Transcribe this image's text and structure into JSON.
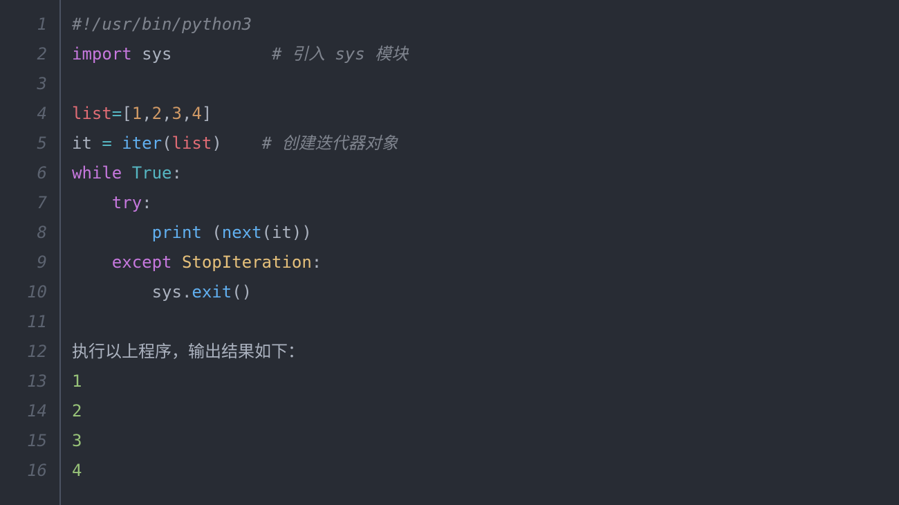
{
  "gutter": {
    "1": "1",
    "2": "2",
    "3": "3",
    "4": "4",
    "5": "5",
    "6": "6",
    "7": "7",
    "8": "8",
    "9": "9",
    "10": "10",
    "11": "11",
    "12": "12",
    "13": "13",
    "14": "14",
    "15": "15",
    "16": "16"
  },
  "t": {
    "shebang": "#!/usr/bin/python3",
    "import": "import",
    "sys": "sys",
    "c_import": "# 引入 sys 模块",
    "list": "list",
    "eq": "=",
    "lbr": "[",
    "n1": "1",
    "n2": "2",
    "n3": "3",
    "n4": "4",
    "comma": ",",
    "rbr": "]",
    "it": "it",
    "sp": " ",
    "iter": "iter",
    "lpar": "(",
    "rpar": ")",
    "c_iter": "# 创建迭代器对象",
    "while": "while",
    "true": "True",
    "colon": ":",
    "try": "try",
    "print": "print",
    "next": "next",
    "except": "except",
    "stopiter": "StopIteration",
    "dot": ".",
    "exit": "exit",
    "outlabel": "执行以上程序，输出结果如下：",
    "o1": "1",
    "o2": "2",
    "o3": "3",
    "o4": "4",
    "ind1": "    ",
    "ind2": "        "
  }
}
